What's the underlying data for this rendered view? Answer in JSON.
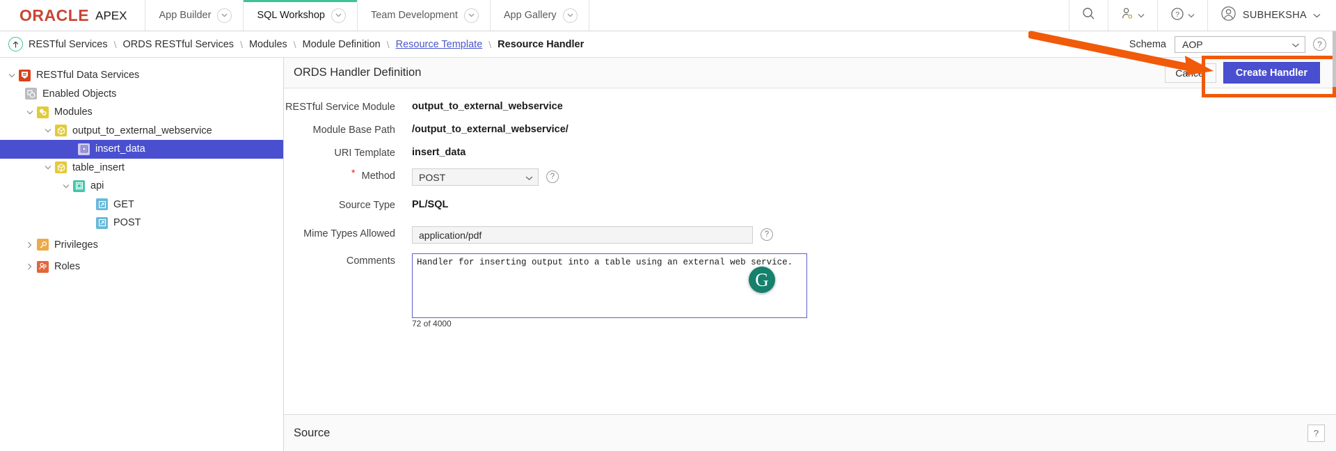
{
  "topnav": {
    "brand_oracle": "ORACLE",
    "brand_apex": "APEX",
    "tabs": [
      {
        "label": "App Builder",
        "active": false
      },
      {
        "label": "SQL Workshop",
        "active": true
      },
      {
        "label": "Team Development",
        "active": false
      },
      {
        "label": "App Gallery",
        "active": false
      }
    ],
    "search_icon": "search-icon",
    "admin_icon": "user-admin-icon",
    "help_icon": "help-circle-icon",
    "avatar_icon": "user-avatar-icon",
    "user_name": "SUBHEKSHA"
  },
  "breadcrumb": {
    "up_icon": "up-arrow-icon",
    "items": [
      {
        "label": "RESTful Services",
        "style": "plain"
      },
      {
        "label": "ORDS RESTful Services",
        "style": "plain"
      },
      {
        "label": "Modules",
        "style": "plain"
      },
      {
        "label": "Module Definition",
        "style": "plain"
      },
      {
        "label": "Resource Template",
        "style": "link"
      },
      {
        "label": "Resource Handler",
        "style": "current"
      }
    ],
    "separator": "\\",
    "schema_label": "Schema",
    "schema_value": "AOP",
    "help_glyph": "?"
  },
  "tree": {
    "nodes": [
      {
        "label": "RESTful Data Services",
        "indent": 0,
        "twist": "down",
        "icon": "restful-data-services-icon",
        "icon_class": "ico-rds",
        "selected": false
      },
      {
        "label": "Enabled Objects",
        "indent": 1,
        "twist": "none",
        "icon": "enabled-objects-icon",
        "icon_class": "ico-enab",
        "selected": false
      },
      {
        "label": "Modules",
        "indent": 1,
        "twist": "down",
        "icon": "modules-icon",
        "icon_class": "ico-mods",
        "selected": false
      },
      {
        "label": "output_to_external_webservice",
        "indent": 2,
        "twist": "down",
        "icon": "module-icon",
        "icon_class": "ico-mod",
        "selected": false
      },
      {
        "label": "insert_data",
        "indent": 3,
        "twist": "none",
        "icon": "resource-template-icon",
        "icon_class": "ico-tmpl",
        "selected": true
      },
      {
        "label": "table_insert",
        "indent": 2,
        "twist": "down",
        "icon": "module-icon",
        "icon_class": "ico-mod",
        "selected": false
      },
      {
        "label": "api",
        "indent": 3,
        "twist": "down",
        "icon": "resource-template-icon",
        "icon_class": "ico-tmpl-g",
        "selected": false
      },
      {
        "label": "GET",
        "indent": 4,
        "twist": "none",
        "icon": "resource-handler-icon",
        "icon_class": "ico-hndl",
        "selected": false
      },
      {
        "label": "POST",
        "indent": 4,
        "twist": "none",
        "icon": "resource-handler-icon",
        "icon_class": "ico-hndl",
        "selected": false
      },
      {
        "label": "Privileges",
        "indent": 1,
        "twist": "right",
        "icon": "privileges-key-icon",
        "icon_class": "ico-priv",
        "selected": false
      },
      {
        "label": "Roles",
        "indent": 1,
        "twist": "right",
        "icon": "roles-people-icon",
        "icon_class": "ico-role",
        "selected": false
      }
    ]
  },
  "panel": {
    "title": "ORDS Handler Definition",
    "cancel_label": "Cancel",
    "create_label": "Create Handler"
  },
  "form": {
    "restful_service_module": {
      "label": "RESTful Service Module",
      "value": "output_to_external_webservice"
    },
    "module_base_path": {
      "label": "Module Base Path",
      "value": "/output_to_external_webservice/"
    },
    "uri_template": {
      "label": "URI Template",
      "value": "insert_data"
    },
    "method": {
      "label": "Method",
      "value": "POST",
      "required": "*",
      "help_glyph": "?"
    },
    "source_type": {
      "label": "Source Type",
      "value": "PL/SQL"
    },
    "mime_types": {
      "label": "Mime Types Allowed",
      "value": "application/pdf",
      "help_glyph": "?"
    },
    "comments": {
      "label": "Comments",
      "value": "Handler for inserting output into a table using an external web service.",
      "char_count": "72 of 4000"
    }
  },
  "grammarly": {
    "glyph": "G",
    "name": "grammarly-badge"
  },
  "source_section": {
    "title": "Source",
    "help_glyph": "?"
  },
  "annotations": {
    "arrow_color": "#f05a09",
    "highlight_color": "#f05a09"
  }
}
